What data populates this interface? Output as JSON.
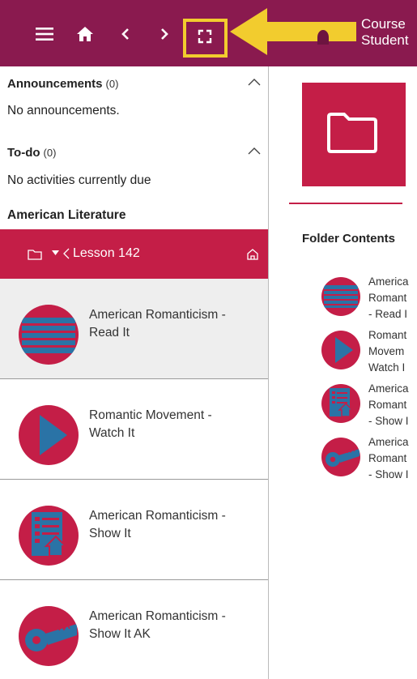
{
  "topbar": {
    "course_title_line1": "Course",
    "course_title_line2": "Student"
  },
  "announcements": {
    "title": "Announcements",
    "count": "(0)",
    "empty_text": "No announcements."
  },
  "todo": {
    "title": "To-do",
    "count": "(0)",
    "empty_text": "No activities currently due"
  },
  "course": {
    "name": "American Literature"
  },
  "lesson": {
    "label": "Lesson 142"
  },
  "items": [
    {
      "line1": "American Romanticism -",
      "line2": "Read It",
      "icon": "read-it-icon",
      "active": true
    },
    {
      "line1": "Romantic Movement -",
      "line2": "Watch It",
      "icon": "watch-it-icon",
      "active": false
    },
    {
      "line1": "American Romanticism -",
      "line2": "Show It",
      "icon": "show-it-icon",
      "active": false
    },
    {
      "line1": "American Romanticism -",
      "line2": "Show It AK",
      "icon": "answer-key-icon",
      "active": false
    }
  ],
  "right": {
    "folder_contents_label": "Folder Contents",
    "items": [
      {
        "l1": "America",
        "l2": "Romant",
        "l3": "- Read I"
      },
      {
        "l1": "Romant",
        "l2": "Movem",
        "l3": "Watch I"
      },
      {
        "l1": "America",
        "l2": "Romant",
        "l3": "- Show I"
      },
      {
        "l1": "America",
        "l2": "Romant",
        "l3": "- Show I"
      }
    ]
  },
  "colors": {
    "topbar": "#8a1a4f",
    "accent": "#c41e47",
    "icon_blue": "#2a73a6",
    "highlight": "#f2cc2e"
  }
}
